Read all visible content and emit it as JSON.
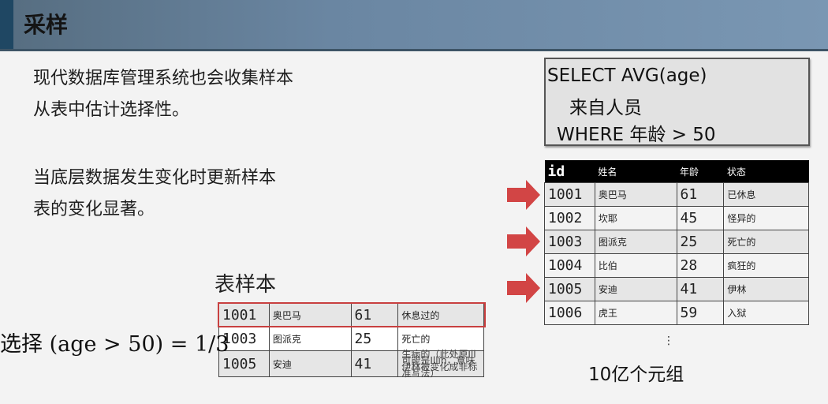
{
  "header": {
    "title": "采样"
  },
  "text": {
    "line1": "现代数据库管理系统也会收集样本",
    "line2": "从表中估计选择性。",
    "line3": "当底层数据发生变化时更新样本",
    "line4": "表的变化显著。"
  },
  "query": {
    "line1": "SELECT AVG(age)",
    "line2": "来自人员",
    "line3": "WHERE 年龄 > 50"
  },
  "table": {
    "headers": [
      "id",
      "姓名",
      "年龄",
      "状态"
    ],
    "rows": [
      [
        "1001",
        "奥巴马",
        "61",
        "已休息"
      ],
      [
        "1002",
        "坎耶",
        "45",
        "怪异的"
      ],
      [
        "1003",
        "图派克",
        "25",
        "死亡的"
      ],
      [
        "1004",
        "比伯",
        "28",
        "疯狂的"
      ],
      [
        "1005",
        "安迪",
        "41",
        "伊林"
      ],
      [
        "1006",
        "虎王",
        "59",
        "入狱"
      ]
    ],
    "ellipsis": "⋮",
    "caption": "10亿个元组"
  },
  "sample": {
    "label": "表样本",
    "rows": [
      [
        "1001",
        "奥巴马",
        "61",
        "休息过的"
      ],
      [
        "1003",
        "图派克",
        "25",
        "死亡的"
      ],
      [
        "1005",
        "安迪",
        "41",
        "生病的（此处原Ill可能是Illin，意味伊林被变化成非标准写法）"
      ]
    ],
    "formula": "选择 (age > 50) = 1/3"
  },
  "colors": {
    "arrow": "#d24545",
    "highlight": "#c84040",
    "title_bar": "#6a86a2",
    "title_accent": "#1f4763"
  }
}
